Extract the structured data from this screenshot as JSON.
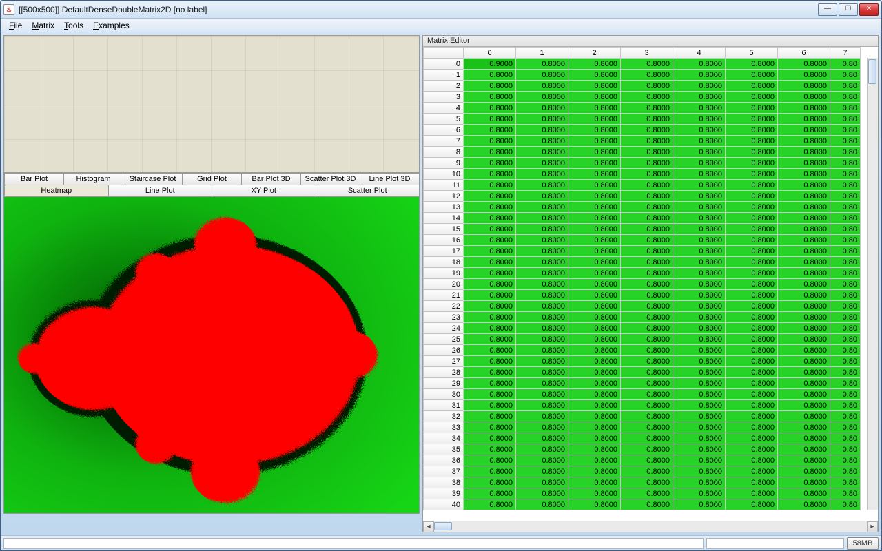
{
  "window": {
    "title": "[[500x500]] DefaultDenseDoubleMatrix2D [no label]"
  },
  "menu": [
    "File",
    "Matrix",
    "Tools",
    "Examples"
  ],
  "tabs_row1": [
    "Bar Plot",
    "Histogram",
    "Staircase Plot",
    "Grid Plot",
    "Bar Plot 3D",
    "Scatter Plot 3D",
    "Line Plot 3D"
  ],
  "tabs_row2": [
    "Heatmap",
    "Line Plot",
    "XY Plot",
    "Scatter Plot"
  ],
  "tabs_active": "Heatmap",
  "matrix_editor": {
    "title": "Matrix Editor"
  },
  "matrix": {
    "col_headers": [
      "0",
      "1",
      "2",
      "3",
      "4",
      "5",
      "6",
      "7"
    ],
    "rows": 41,
    "first_cell": "0.9000",
    "cell_value": "0.8000",
    "last_col_value": "0.80"
  },
  "status": {
    "memory": "58MB"
  },
  "chart_data": {
    "type": "heatmap",
    "title": "",
    "description": "Mandelbrot-set heatmap; interior rendered red, exterior green gradient by escape iteration count",
    "matrix_shape": [
      500,
      500
    ],
    "value_range": [
      0.0,
      0.9
    ],
    "sample_values_top_left": [
      [
        0.9,
        0.8,
        0.8,
        0.8,
        0.8,
        0.8,
        0.8,
        0.8
      ]
    ],
    "colormap": {
      "low": "#ff0000",
      "mid": "#004400",
      "high": "#00dd00"
    }
  }
}
